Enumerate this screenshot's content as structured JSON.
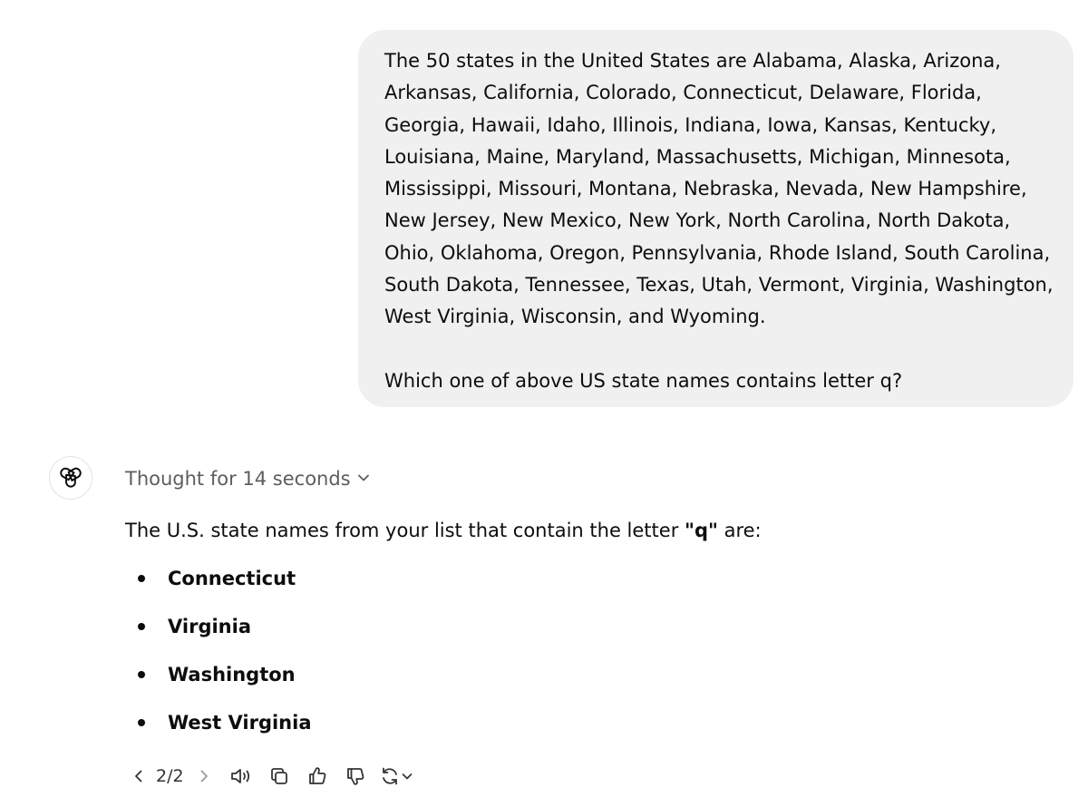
{
  "conversation": {
    "user_message": {
      "lines": [
        "The 50 states in the United States are Alabama, Alaska, Arizona,",
        "Arkansas, California, Colorado, Connecticut, Delaware, Florida,",
        "Georgia, Hawaii, Idaho, Illinois, Indiana, Iowa, Kansas, Kentucky,",
        "Louisiana, Maine, Maryland, Massachusetts, Michigan, Minnesota,",
        "Mississippi, Missouri, Montana, Nebraska, Nevada, New Hampshire,",
        "New Jersey, New Mexico, New York, North Carolina, North Dakota,",
        "Ohio, Oklahoma, Oregon, Pennsylvania, Rhode Island, South Carolina,",
        "South Dakota, Tennessee, Texas, Utah, Vermont, Virginia, Washington,",
        "West Virginia, Wisconsin, and Wyoming."
      ],
      "question": "Which one of above US state names contains letter q?"
    },
    "assistant": {
      "avatar_icon": "openai-logo-icon",
      "thought_label": "Thought for 14 seconds",
      "intro_before": "The U.S. state names from your list that contain the letter ",
      "intro_bold": "\"q\"",
      "intro_after": " are:",
      "answers": [
        "Connecticut",
        "Virginia",
        "Washington",
        "West Virginia"
      ]
    }
  },
  "action_bar": {
    "pager": "2/2",
    "icons": [
      "chevron-left-icon",
      "chevron-right-icon",
      "read-aloud-icon",
      "copy-icon",
      "thumbs-up-icon",
      "thumbs-down-icon",
      "regenerate-icon",
      "chevron-down-icon"
    ]
  }
}
